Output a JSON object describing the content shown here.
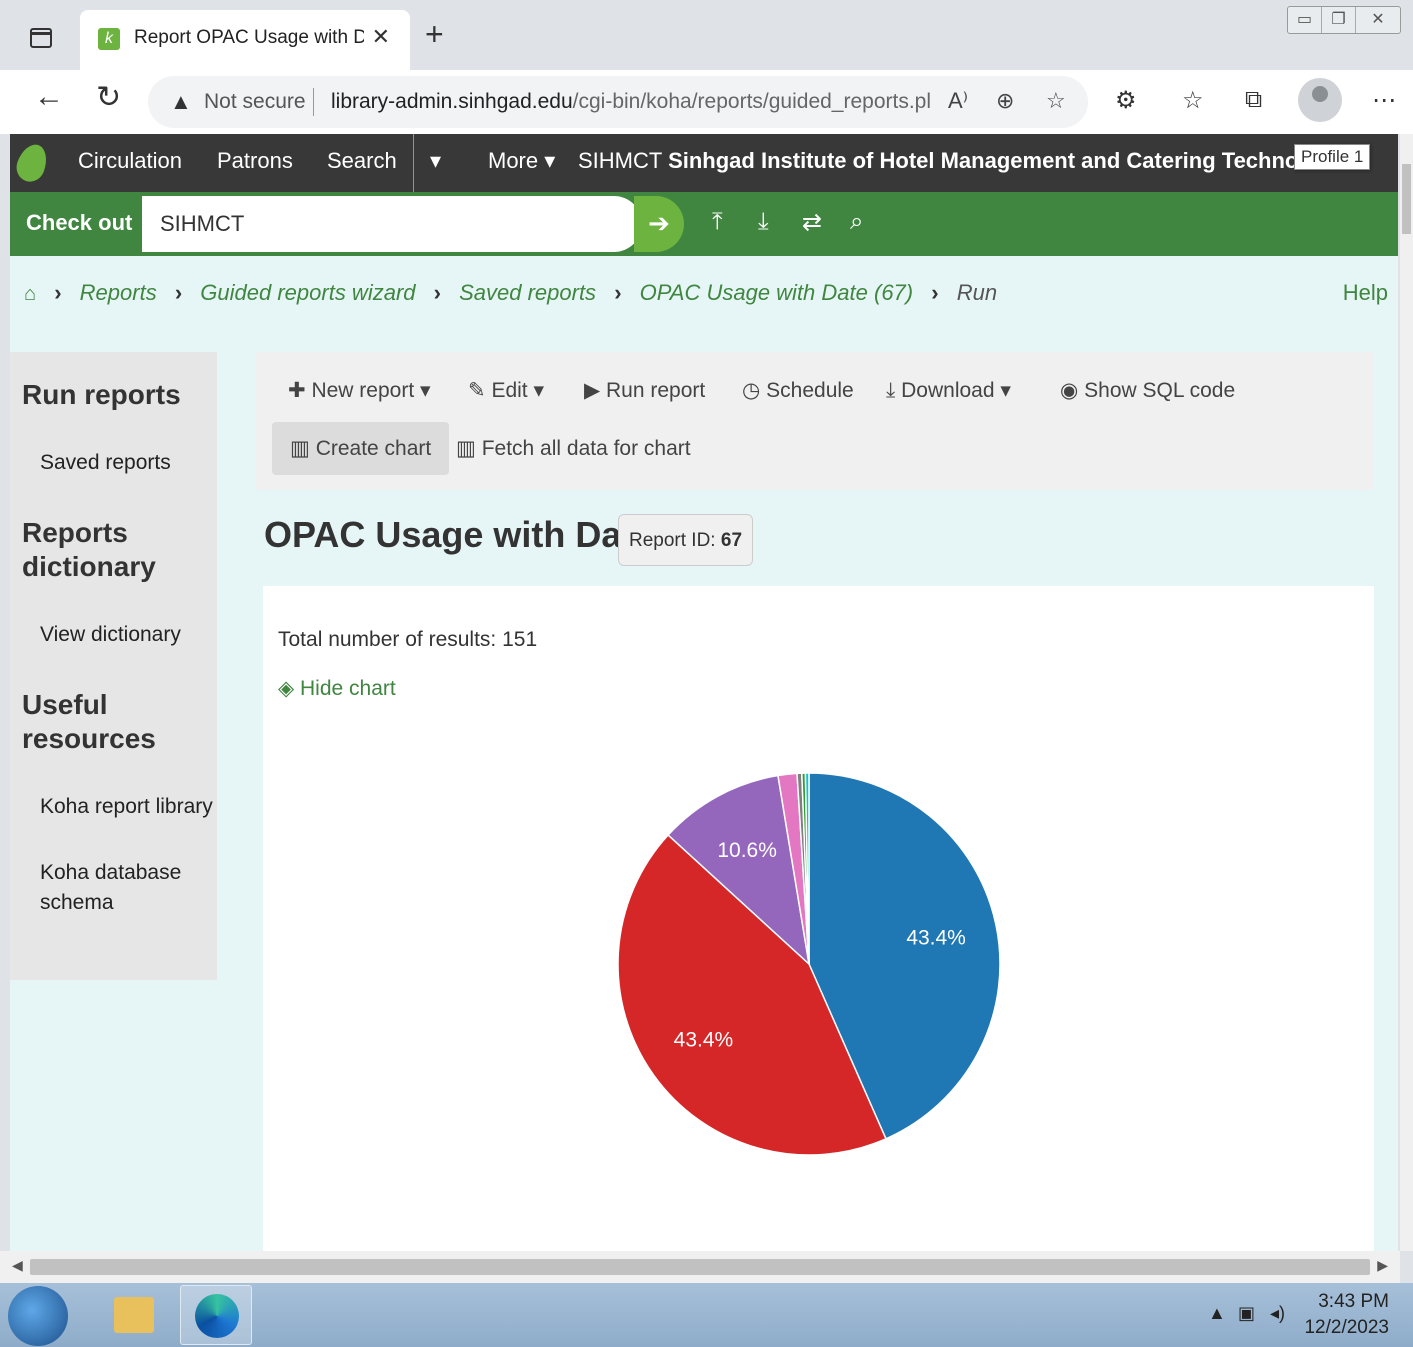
{
  "browser": {
    "tab_title": "Report OPAC Usage with Date (",
    "tab_favicon": "k",
    "address_warning": "Not secure",
    "url_host": "library-admin.sinhgad.edu",
    "url_path": "/cgi-bin/koha/reports/guided_reports.pl?p...",
    "profile_tooltip": "Profile 1"
  },
  "topnav": {
    "items": [
      "Circulation",
      "Patrons",
      "Search",
      "More"
    ],
    "library_code": "SIHMCT",
    "library_name": "Sinhgad Institute of Hotel Management and Catering Technology (SIH"
  },
  "checkout": {
    "label": "Check out",
    "branch_value": "SIHMCT"
  },
  "breadcrumb": {
    "items": [
      "Reports",
      "Guided reports wizard",
      "Saved reports",
      "OPAC Usage with Date (67)"
    ],
    "current": "Run",
    "help": "Help"
  },
  "sidebar": {
    "run_reports": "Run reports",
    "saved_reports": "Saved reports",
    "reports_dictionary_1": "Reports",
    "reports_dictionary_2": "dictionary",
    "view_dictionary": "View dictionary",
    "useful_1": "Useful",
    "useful_2": "resources",
    "koha_report_library": "Koha report library",
    "koha_db_schema_1": "Koha database",
    "koha_db_schema_2": "schema"
  },
  "toolbar": {
    "new_report": "New report",
    "edit": "Edit",
    "run_report": "Run report",
    "schedule": "Schedule",
    "download": "Download",
    "show_sql": "Show SQL code",
    "create_chart": "Create chart",
    "fetch_all": "Fetch all data for chart"
  },
  "report": {
    "title": "OPAC Usage with Date",
    "id_label": "Report ID:",
    "id_value": "67",
    "total_label": "Total number of results:",
    "total_value": "151",
    "hide_chart": "Hide chart"
  },
  "chart_data": {
    "type": "pie",
    "title": "",
    "slices": [
      {
        "value": 43.4,
        "label": "43.4%",
        "color": "#1f77b4"
      },
      {
        "value": 43.4,
        "label": "43.4%",
        "color": "#d62728"
      },
      {
        "value": 10.6,
        "label": "10.6%",
        "color": "#9467bd"
      },
      {
        "value": 1.6,
        "label": "",
        "color": "#e377c2"
      },
      {
        "value": 0.4,
        "label": "",
        "color": "#7f7f7f"
      },
      {
        "value": 0.3,
        "label": "",
        "color": "#2ca02c"
      },
      {
        "value": 0.3,
        "label": "",
        "color": "#17becf"
      }
    ]
  },
  "taskbar": {
    "time": "3:43 PM",
    "date": "12/2/2023"
  },
  "colors": {
    "koha_green": "#408540",
    "koha_light_green": "#6db33f",
    "nav_dark": "#383838"
  }
}
